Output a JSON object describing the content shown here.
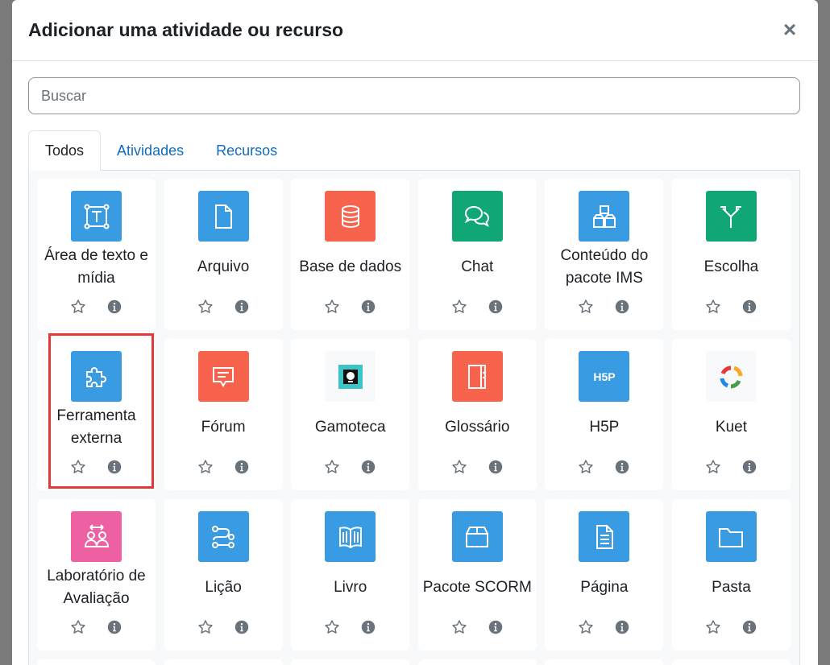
{
  "modal": {
    "title": "Adicionar uma atividade ou recurso",
    "close_label": "×"
  },
  "search": {
    "placeholder": "Buscar",
    "value": ""
  },
  "tabs": [
    {
      "label": "Todos",
      "active": true
    },
    {
      "label": "Atividades",
      "active": false
    },
    {
      "label": "Recursos",
      "active": false
    }
  ],
  "modules": [
    {
      "label": "Área de texto e mídia",
      "icon": "text-media-icon",
      "color": "#399be2"
    },
    {
      "label": "Arquivo",
      "icon": "file-icon",
      "color": "#399be2"
    },
    {
      "label": "Base de dados",
      "icon": "database-icon",
      "color": "#f7634d"
    },
    {
      "label": "Chat",
      "icon": "chat-icon",
      "color": "#11a676"
    },
    {
      "label": "Conteúdo do pacote IMS",
      "icon": "ims-package-icon",
      "color": "#399be2"
    },
    {
      "label": "Escolha",
      "icon": "choice-icon",
      "color": "#11a676"
    },
    {
      "label": "Ferramenta externa",
      "icon": "puzzle-icon",
      "color": "#399be2"
    },
    {
      "label": "Fórum",
      "icon": "forum-icon",
      "color": "#f7634d"
    },
    {
      "label": "Gamoteca",
      "icon": "gamoteca-icon",
      "color": "#f8f9fa"
    },
    {
      "label": "Glossário",
      "icon": "glossary-icon",
      "color": "#f7634d"
    },
    {
      "label": "H5P",
      "icon": "h5p-icon",
      "color": "#399be2"
    },
    {
      "label": "Kuet",
      "icon": "kuet-icon",
      "color": "#f8f9fa"
    },
    {
      "label": "Laboratório de Avaliação",
      "icon": "workshop-icon",
      "color": "#ed61a3"
    },
    {
      "label": "Lição",
      "icon": "lesson-icon",
      "color": "#399be2"
    },
    {
      "label": "Livro",
      "icon": "book-icon",
      "color": "#399be2"
    },
    {
      "label": "Pacote SCORM",
      "icon": "scorm-icon",
      "color": "#399be2"
    },
    {
      "label": "Página",
      "icon": "page-icon",
      "color": "#399be2"
    },
    {
      "label": "Pasta",
      "icon": "folder-icon",
      "color": "#399be2"
    }
  ],
  "highlighted_module": "Ferramenta externa",
  "colors": {
    "link": "#0f6cbf",
    "highlight_border": "#e53935",
    "action_icon": "#6a737b"
  }
}
